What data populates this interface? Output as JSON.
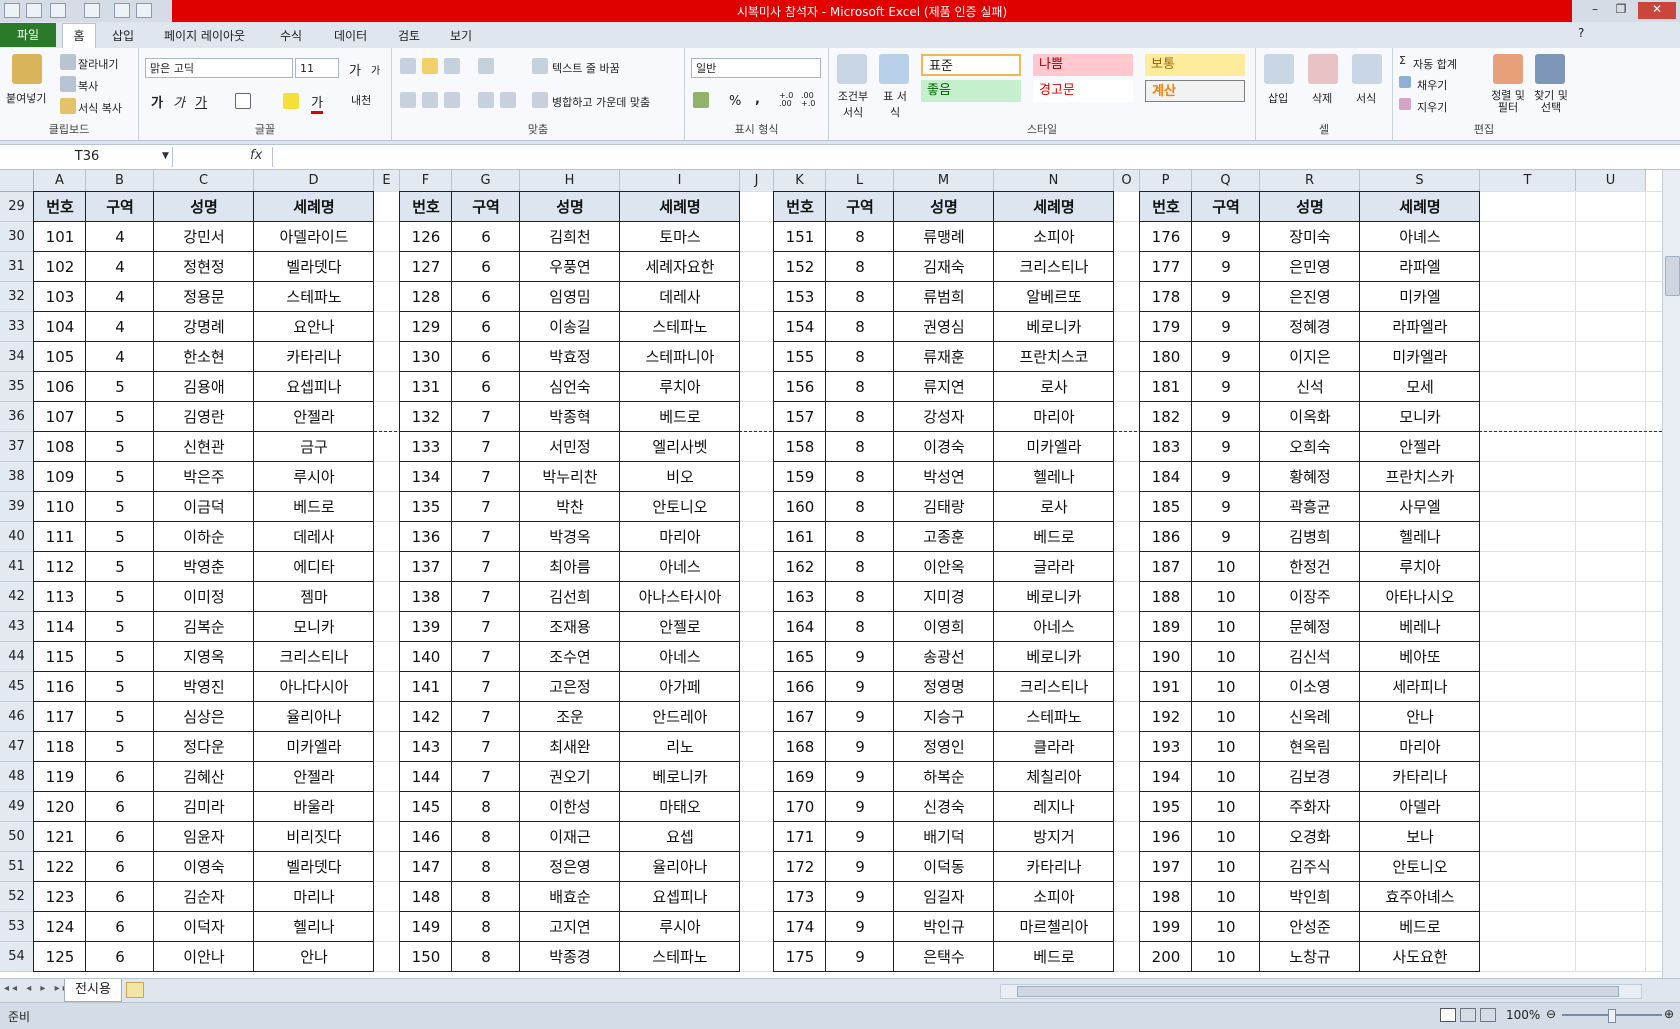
{
  "window": {
    "title": "시복미사 참석자 - Microsoft Excel (제품 인증 실패)"
  },
  "tabs": [
    "파일",
    "홈",
    "삽입",
    "페이지 레이아웃",
    "수식",
    "데이터",
    "검토",
    "보기"
  ],
  "ribbon": {
    "clipboard": {
      "paste": "붙여넣기",
      "cut": "잘라내기",
      "copy": "복사",
      "format_painter": "서식 복사",
      "label": "클립보드"
    },
    "font": {
      "name": "맑은 고딕",
      "size": "11",
      "label": "글꼴",
      "grow": "가",
      "shrink": "가",
      "bold": "가",
      "italic": "가",
      "underline": "가",
      "color_glyph": "가",
      "phonetic": "내천"
    },
    "alignment": {
      "wrap": "텍스트 줄 바꿈",
      "merge": "병합하고 가운데 맞춤",
      "label": "맞춤"
    },
    "number": {
      "format": "일반",
      "percent": "%",
      "comma": ",",
      "inc_decimal": "+.0 .00",
      "dec_decimal": ".00 +.0",
      "label": "표시 형식"
    },
    "styles": {
      "conditional": "조건부 서식",
      "table": "표 서식",
      "normal": "표준",
      "bad": "나쁨",
      "neutral": "보통",
      "good": "좋음",
      "warning": "경고문",
      "calc": "계산",
      "label": "스타일"
    },
    "cells": {
      "insert": "삽입",
      "delete": "삭제",
      "format": "서식",
      "label": "셀"
    },
    "editing": {
      "autosum": "자동 합계",
      "fill": "채우기",
      "clear": "지우기",
      "sort": "정렬 및 필터",
      "find": "찾기 및 선택",
      "label": "편집"
    }
  },
  "formula_bar": {
    "name_box": "T36",
    "fx": "fx",
    "value": ""
  },
  "columns": [
    "A",
    "B",
    "C",
    "D",
    "E",
    "F",
    "G",
    "H",
    "I",
    "J",
    "K",
    "L",
    "M",
    "N",
    "O",
    "P",
    "Q",
    "R",
    "S",
    "T",
    "U"
  ],
  "rows": [
    "29",
    "30",
    "31",
    "32",
    "33",
    "34",
    "35",
    "36",
    "37",
    "38",
    "39",
    "40",
    "41",
    "42",
    "43",
    "44",
    "45",
    "46",
    "47",
    "48",
    "49",
    "50",
    "51",
    "52",
    "53",
    "54"
  ],
  "headers": [
    "번호",
    "구역",
    "성명",
    "세례명"
  ],
  "blocks": [
    {
      "rows": [
        [
          "101",
          "4",
          "강민서",
          "아델라이드"
        ],
        [
          "102",
          "4",
          "정현정",
          "벨라뎃다"
        ],
        [
          "103",
          "4",
          "정용문",
          "스테파노"
        ],
        [
          "104",
          "4",
          "강명례",
          "요안나"
        ],
        [
          "105",
          "4",
          "한소현",
          "카타리나"
        ],
        [
          "106",
          "5",
          "김용애",
          "요셉피나"
        ],
        [
          "107",
          "5",
          "김영란",
          "안젤라"
        ],
        [
          "108",
          "5",
          "신현관",
          "금구"
        ],
        [
          "109",
          "5",
          "박은주",
          "루시아"
        ],
        [
          "110",
          "5",
          "이금덕",
          "베드로"
        ],
        [
          "111",
          "5",
          "이하순",
          "데레사"
        ],
        [
          "112",
          "5",
          "박영춘",
          "에디타"
        ],
        [
          "113",
          "5",
          "이미정",
          "젬마"
        ],
        [
          "114",
          "5",
          "김복순",
          "모니카"
        ],
        [
          "115",
          "5",
          "지영옥",
          "크리스티나"
        ],
        [
          "116",
          "5",
          "박영진",
          "아나다시아"
        ],
        [
          "117",
          "5",
          "심상은",
          "율리아나"
        ],
        [
          "118",
          "5",
          "정다운",
          "미카엘라"
        ],
        [
          "119",
          "6",
          "김혜산",
          "안젤라"
        ],
        [
          "120",
          "6",
          "김미라",
          "바울라"
        ],
        [
          "121",
          "6",
          "임윤자",
          "비리짓다"
        ],
        [
          "122",
          "6",
          "이영숙",
          "벨라뎃다"
        ],
        [
          "123",
          "6",
          "김순자",
          "마리나"
        ],
        [
          "124",
          "6",
          "이덕자",
          "헬리나"
        ],
        [
          "125",
          "6",
          "이안나",
          "안나"
        ]
      ]
    },
    {
      "rows": [
        [
          "126",
          "6",
          "김희천",
          "토마스"
        ],
        [
          "127",
          "6",
          "우풍연",
          "세례자요한"
        ],
        [
          "128",
          "6",
          "임영밈",
          "데레사"
        ],
        [
          "129",
          "6",
          "이송길",
          "스테파노"
        ],
        [
          "130",
          "6",
          "박효정",
          "스테파니아"
        ],
        [
          "131",
          "6",
          "심언숙",
          "루치아"
        ],
        [
          "132",
          "7",
          "박종혁",
          "베드로"
        ],
        [
          "133",
          "7",
          "서민정",
          "엘리사벳"
        ],
        [
          "134",
          "7",
          "박누리찬",
          "비오"
        ],
        [
          "135",
          "7",
          "박찬",
          "안토니오"
        ],
        [
          "136",
          "7",
          "박경옥",
          "마리아"
        ],
        [
          "137",
          "7",
          "최아름",
          "아네스"
        ],
        [
          "138",
          "7",
          "김선희",
          "아나스타시아"
        ],
        [
          "139",
          "7",
          "조재용",
          "안젤로"
        ],
        [
          "140",
          "7",
          "조수연",
          "아네스"
        ],
        [
          "141",
          "7",
          "고은정",
          "아가페"
        ],
        [
          "142",
          "7",
          "조운",
          "안드레아"
        ],
        [
          "143",
          "7",
          "최새완",
          "리노"
        ],
        [
          "144",
          "7",
          "권오기",
          "베로니카"
        ],
        [
          "145",
          "8",
          "이한성",
          "마태오"
        ],
        [
          "146",
          "8",
          "이재근",
          "요셉"
        ],
        [
          "147",
          "8",
          "정은영",
          "율리아나"
        ],
        [
          "148",
          "8",
          "배효순",
          "요셉피나"
        ],
        [
          "149",
          "8",
          "고지연",
          "루시아"
        ],
        [
          "150",
          "8",
          "박종경",
          "스테파노"
        ]
      ]
    },
    {
      "rows": [
        [
          "151",
          "8",
          "류맹례",
          "소피아"
        ],
        [
          "152",
          "8",
          "김재숙",
          "크리스티나"
        ],
        [
          "153",
          "8",
          "류범희",
          "알베르또"
        ],
        [
          "154",
          "8",
          "권영심",
          "베로니카"
        ],
        [
          "155",
          "8",
          "류재훈",
          "프란치스코"
        ],
        [
          "156",
          "8",
          "류지연",
          "로사"
        ],
        [
          "157",
          "8",
          "강성자",
          "마리아"
        ],
        [
          "158",
          "8",
          "이경숙",
          "미카엘라"
        ],
        [
          "159",
          "8",
          "박성연",
          "헬레나"
        ],
        [
          "160",
          "8",
          "김태랑",
          "로사"
        ],
        [
          "161",
          "8",
          "고종훈",
          "베드로"
        ],
        [
          "162",
          "8",
          "이안옥",
          "글라라"
        ],
        [
          "163",
          "8",
          "지미경",
          "베로니카"
        ],
        [
          "164",
          "8",
          "이영희",
          "아네스"
        ],
        [
          "165",
          "9",
          "송광선",
          "베로니카"
        ],
        [
          "166",
          "9",
          "정영명",
          "크리스티나"
        ],
        [
          "167",
          "9",
          "지승구",
          "스테파노"
        ],
        [
          "168",
          "9",
          "정영인",
          "클라라"
        ],
        [
          "169",
          "9",
          "하복순",
          "체칠리아"
        ],
        [
          "170",
          "9",
          "신경숙",
          "레지나"
        ],
        [
          "171",
          "9",
          "배기덕",
          "방지거"
        ],
        [
          "172",
          "9",
          "이덕동",
          "카타리나"
        ],
        [
          "173",
          "9",
          "임길자",
          "소피아"
        ],
        [
          "174",
          "9",
          "박인규",
          "마르첼리아"
        ],
        [
          "175",
          "9",
          "은택수",
          "베드로"
        ]
      ]
    },
    {
      "rows": [
        [
          "176",
          "9",
          "장미숙",
          "아녜스"
        ],
        [
          "177",
          "9",
          "은민영",
          "라파엘"
        ],
        [
          "178",
          "9",
          "은진영",
          "미카엘"
        ],
        [
          "179",
          "9",
          "정혜경",
          "라파엘라"
        ],
        [
          "180",
          "9",
          "이지은",
          "미카엘라"
        ],
        [
          "181",
          "9",
          "신석",
          "모세"
        ],
        [
          "182",
          "9",
          "이옥화",
          "모니카"
        ],
        [
          "183",
          "9",
          "오희숙",
          "안젤라"
        ],
        [
          "184",
          "9",
          "황혜정",
          "프란치스카"
        ],
        [
          "185",
          "9",
          "곽흥균",
          "사무엘"
        ],
        [
          "186",
          "9",
          "김병희",
          "헬레나"
        ],
        [
          "187",
          "10",
          "한정건",
          "루치아"
        ],
        [
          "188",
          "10",
          "이장주",
          "아타나시오"
        ],
        [
          "189",
          "10",
          "문혜정",
          "베레나"
        ],
        [
          "190",
          "10",
          "김신석",
          "베아또"
        ],
        [
          "191",
          "10",
          "이소영",
          "세라피나"
        ],
        [
          "192",
          "10",
          "신옥례",
          "안나"
        ],
        [
          "193",
          "10",
          "현옥림",
          "마리아"
        ],
        [
          "194",
          "10",
          "김보경",
          "카타리나"
        ],
        [
          "195",
          "10",
          "주화자",
          "아델라"
        ],
        [
          "196",
          "10",
          "오경화",
          "보나"
        ],
        [
          "197",
          "10",
          "김주식",
          "안토니오"
        ],
        [
          "198",
          "10",
          "박인희",
          "효주아녜스"
        ],
        [
          "199",
          "10",
          "안성준",
          "베드로"
        ],
        [
          "200",
          "10",
          "노창규",
          "사도요한"
        ]
      ]
    }
  ],
  "sheet_tabs": [
    "전시용"
  ],
  "status": {
    "ready": "준비",
    "zoom": "100%"
  }
}
